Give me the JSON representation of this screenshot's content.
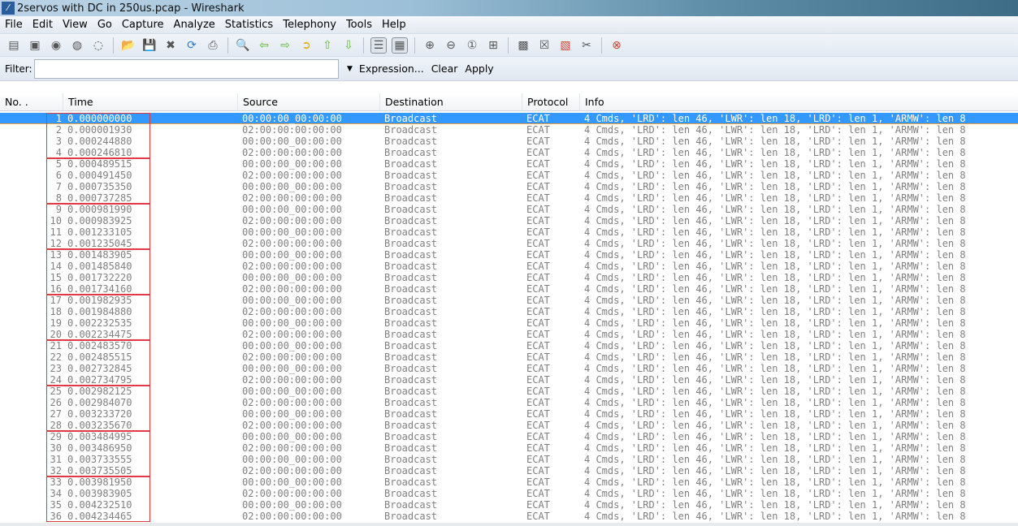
{
  "window": {
    "title": "2servos with DC in 250us.pcap - Wireshark"
  },
  "menu": [
    "File",
    "Edit",
    "View",
    "Go",
    "Capture",
    "Analyze",
    "Statistics",
    "Telephony",
    "Tools",
    "Help"
  ],
  "toolbar": [
    "interface-list-icon",
    "capture-options-icon",
    "start-capture-icon",
    "stop-capture-icon",
    "restart-capture-icon",
    "open-icon",
    "save-icon",
    "close-icon",
    "reload-icon",
    "print-icon",
    "find-icon",
    "go-back-icon",
    "go-forward-icon",
    "go-to-packet-icon",
    "first-packet-icon",
    "last-packet-icon",
    "colorize-icon",
    "auto-scroll-icon",
    "zoom-in-icon",
    "zoom-out-icon",
    "normal-size-icon",
    "resize-columns-icon",
    "capture-filters-icon",
    "display-filters-icon",
    "coloring-rules-icon",
    "preferences-icon",
    "help-icon"
  ],
  "filter": {
    "label": "Filter:",
    "value": "",
    "expression": "Expression...",
    "clear": "Clear",
    "apply": "Apply"
  },
  "columns": [
    "No. .",
    "Time",
    "Source",
    "Destination",
    "Protocol",
    "Info"
  ],
  "info_text": "4 Cmds, 'LRD': len 46, 'LWR': len 18, 'LRD': len 1, 'ARMW': len 8",
  "packets": [
    {
      "no": "1",
      "time": "0.000000000",
      "src": "00:00:00_00:00:00",
      "dst": "Broadcast",
      "proto": "ECAT"
    },
    {
      "no": "2",
      "time": "0.000001930",
      "src": "02:00:00:00:00:00",
      "dst": "Broadcast",
      "proto": "ECAT"
    },
    {
      "no": "3",
      "time": "0.000244880",
      "src": "00:00:00_00:00:00",
      "dst": "Broadcast",
      "proto": "ECAT"
    },
    {
      "no": "4",
      "time": "0.000246810",
      "src": "02:00:00:00:00:00",
      "dst": "Broadcast",
      "proto": "ECAT"
    },
    {
      "no": "5",
      "time": "0.000489515",
      "src": "00:00:00_00:00:00",
      "dst": "Broadcast",
      "proto": "ECAT"
    },
    {
      "no": "6",
      "time": "0.000491450",
      "src": "02:00:00:00:00:00",
      "dst": "Broadcast",
      "proto": "ECAT"
    },
    {
      "no": "7",
      "time": "0.000735350",
      "src": "00:00:00_00:00:00",
      "dst": "Broadcast",
      "proto": "ECAT"
    },
    {
      "no": "8",
      "time": "0.000737285",
      "src": "02:00:00:00:00:00",
      "dst": "Broadcast",
      "proto": "ECAT"
    },
    {
      "no": "9",
      "time": "0.000981990",
      "src": "00:00:00_00:00:00",
      "dst": "Broadcast",
      "proto": "ECAT"
    },
    {
      "no": "10",
      "time": "0.000983925",
      "src": "02:00:00:00:00:00",
      "dst": "Broadcast",
      "proto": "ECAT"
    },
    {
      "no": "11",
      "time": "0.001233105",
      "src": "00:00:00_00:00:00",
      "dst": "Broadcast",
      "proto": "ECAT"
    },
    {
      "no": "12",
      "time": "0.001235045",
      "src": "02:00:00:00:00:00",
      "dst": "Broadcast",
      "proto": "ECAT"
    },
    {
      "no": "13",
      "time": "0.001483905",
      "src": "00:00:00_00:00:00",
      "dst": "Broadcast",
      "proto": "ECAT"
    },
    {
      "no": "14",
      "time": "0.001485840",
      "src": "02:00:00:00:00:00",
      "dst": "Broadcast",
      "proto": "ECAT"
    },
    {
      "no": "15",
      "time": "0.001732220",
      "src": "00:00:00_00:00:00",
      "dst": "Broadcast",
      "proto": "ECAT"
    },
    {
      "no": "16",
      "time": "0.001734160",
      "src": "02:00:00:00:00:00",
      "dst": "Broadcast",
      "proto": "ECAT"
    },
    {
      "no": "17",
      "time": "0.001982935",
      "src": "00:00:00_00:00:00",
      "dst": "Broadcast",
      "proto": "ECAT"
    },
    {
      "no": "18",
      "time": "0.001984880",
      "src": "02:00:00:00:00:00",
      "dst": "Broadcast",
      "proto": "ECAT"
    },
    {
      "no": "19",
      "time": "0.002232535",
      "src": "00:00:00_00:00:00",
      "dst": "Broadcast",
      "proto": "ECAT"
    },
    {
      "no": "20",
      "time": "0.002234475",
      "src": "02:00:00:00:00:00",
      "dst": "Broadcast",
      "proto": "ECAT"
    },
    {
      "no": "21",
      "time": "0.002483570",
      "src": "00:00:00_00:00:00",
      "dst": "Broadcast",
      "proto": "ECAT"
    },
    {
      "no": "22",
      "time": "0.002485515",
      "src": "02:00:00:00:00:00",
      "dst": "Broadcast",
      "proto": "ECAT"
    },
    {
      "no": "23",
      "time": "0.002732845",
      "src": "00:00:00_00:00:00",
      "dst": "Broadcast",
      "proto": "ECAT"
    },
    {
      "no": "24",
      "time": "0.002734795",
      "src": "02:00:00:00:00:00",
      "dst": "Broadcast",
      "proto": "ECAT"
    },
    {
      "no": "25",
      "time": "0.002982125",
      "src": "00:00:00_00:00:00",
      "dst": "Broadcast",
      "proto": "ECAT"
    },
    {
      "no": "26",
      "time": "0.002984070",
      "src": "02:00:00:00:00:00",
      "dst": "Broadcast",
      "proto": "ECAT"
    },
    {
      "no": "27",
      "time": "0.003233720",
      "src": "00:00:00_00:00:00",
      "dst": "Broadcast",
      "proto": "ECAT"
    },
    {
      "no": "28",
      "time": "0.003235670",
      "src": "02:00:00:00:00:00",
      "dst": "Broadcast",
      "proto": "ECAT"
    },
    {
      "no": "29",
      "time": "0.003484995",
      "src": "00:00:00_00:00:00",
      "dst": "Broadcast",
      "proto": "ECAT"
    },
    {
      "no": "30",
      "time": "0.003486950",
      "src": "02:00:00:00:00:00",
      "dst": "Broadcast",
      "proto": "ECAT"
    },
    {
      "no": "31",
      "time": "0.003733555",
      "src": "00:00:00_00:00:00",
      "dst": "Broadcast",
      "proto": "ECAT"
    },
    {
      "no": "32",
      "time": "0.003735505",
      "src": "02:00:00:00:00:00",
      "dst": "Broadcast",
      "proto": "ECAT"
    },
    {
      "no": "33",
      "time": "0.003981950",
      "src": "00:00:00_00:00:00",
      "dst": "Broadcast",
      "proto": "ECAT"
    },
    {
      "no": "34",
      "time": "0.003983905",
      "src": "02:00:00:00:00:00",
      "dst": "Broadcast",
      "proto": "ECAT"
    },
    {
      "no": "35",
      "time": "0.004232510",
      "src": "00:00:00_00:00:00",
      "dst": "Broadcast",
      "proto": "ECAT"
    },
    {
      "no": "36",
      "time": "0.004234465",
      "src": "02:00:00:00:00:00",
      "dst": "Broadcast",
      "proto": "ECAT"
    }
  ],
  "selected_row": 1,
  "colors": {
    "selection": "#3399ff",
    "annotation": "#e03a44",
    "row_text": "#808080"
  }
}
